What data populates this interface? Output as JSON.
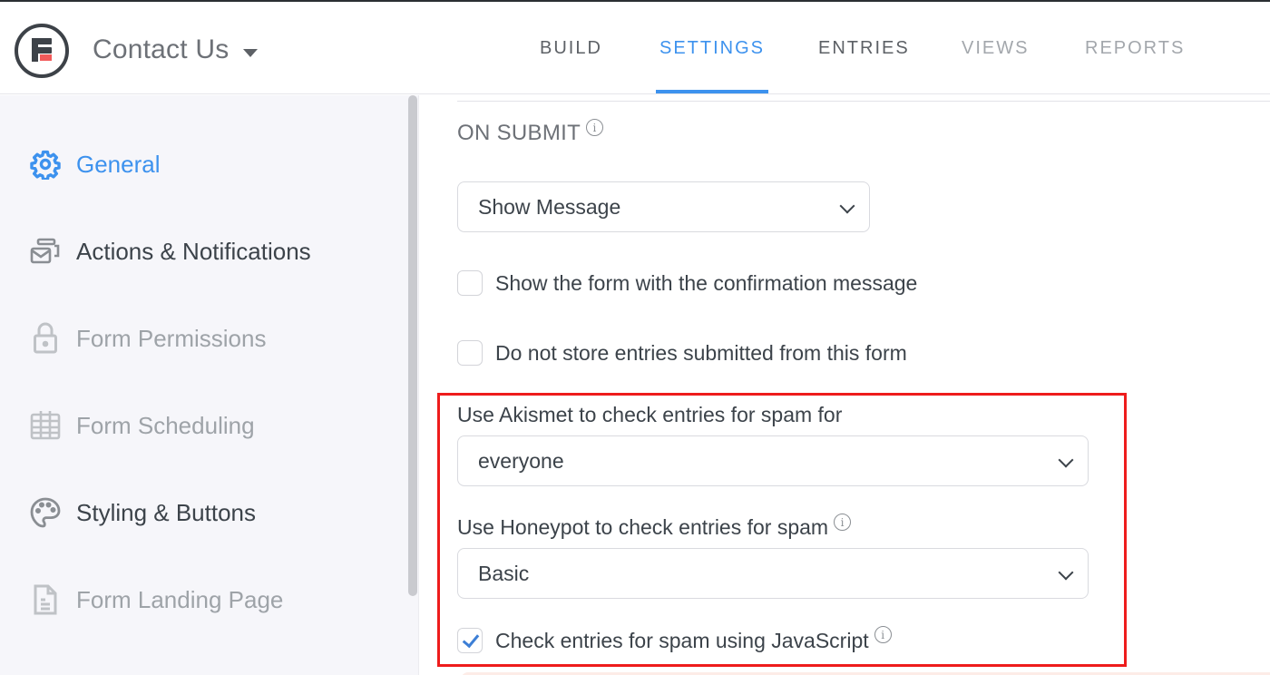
{
  "header": {
    "logo_icon": "formidable-forms-logo",
    "form_title": "Contact Us",
    "form_title_dropdown_icon": "caret-down-icon",
    "tabs": [
      {
        "label": "BUILD",
        "state": "normal"
      },
      {
        "label": "SETTINGS",
        "state": "active"
      },
      {
        "label": "ENTRIES",
        "state": "normal"
      },
      {
        "label": "VIEWS",
        "state": "disabled"
      },
      {
        "label": "REPORTS",
        "state": "disabled"
      }
    ]
  },
  "sidebar": {
    "items": [
      {
        "label": "General",
        "icon": "gear-icon",
        "state": "active"
      },
      {
        "label": "Actions & Notifications",
        "icon": "envelope-stack-icon",
        "state": "normal"
      },
      {
        "label": "Form Permissions",
        "icon": "lock-icon",
        "state": "muted"
      },
      {
        "label": "Form Scheduling",
        "icon": "calendar-icon",
        "state": "muted"
      },
      {
        "label": "Styling & Buttons",
        "icon": "palette-icon",
        "state": "normal"
      },
      {
        "label": "Form Landing Page",
        "icon": "document-icon",
        "state": "muted"
      }
    ]
  },
  "main": {
    "on_submit": {
      "title": "ON SUBMIT",
      "info_icon": "info-icon",
      "selected": "Show Message"
    },
    "checkboxes": [
      {
        "label": "Show the form with the confirmation message",
        "checked": false
      },
      {
        "label": "Do not store entries submitted from this form",
        "checked": false
      }
    ],
    "akismet": {
      "label": "Use Akismet to check entries for spam for",
      "selected": "everyone"
    },
    "honeypot": {
      "label": "Use Honeypot to check entries for spam",
      "selected": "Basic"
    },
    "javascript_check": {
      "label": "Check entries for spam using JavaScript",
      "checked": true
    }
  },
  "colors": {
    "accent": "#3d92ee",
    "highlight_border": "#ee1c1c",
    "sidebar_bg": "#f6f6fa",
    "text": "#3c434a",
    "muted_text": "#9ea3a8"
  },
  "info_glyph": "i"
}
